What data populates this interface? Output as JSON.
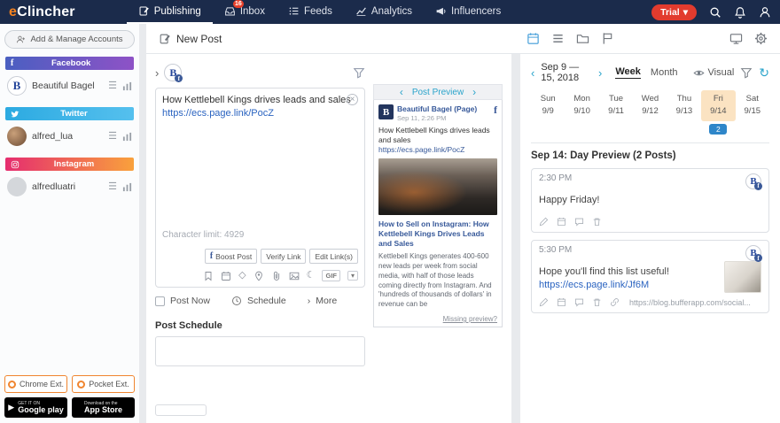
{
  "colors": {
    "brand_orange": "#f5821f",
    "navbar_navy": "#1b2b4b",
    "trial_red": "#e23b2e",
    "facebook_bar": "#4a5fc1",
    "twitter_bar": "#2caae1",
    "instagram_bar": "#e52d6f",
    "link_blue": "#365899",
    "selected_day_bg": "#fbe3c2",
    "count_badge_blue": "#2e86c9",
    "inbox_badge_red": "#e8402a"
  },
  "navbar": {
    "logo_prefix": "e",
    "logo_rest": "Clincher",
    "items": [
      {
        "label": "Publishing"
      },
      {
        "label": "Inbox",
        "badge": "16"
      },
      {
        "label": "Feeds"
      },
      {
        "label": "Analytics"
      },
      {
        "label": "Influencers"
      }
    ],
    "trial_label": "Trial"
  },
  "sidebar": {
    "add_accounts_label": "Add & Manage Accounts",
    "facebook": {
      "network": "Facebook",
      "account": "Beautiful Bagel"
    },
    "twitter": {
      "network": "Twitter",
      "account": "alfred_lua"
    },
    "instagram": {
      "network": "Instagram",
      "account": "alfredluatri"
    },
    "chrome_ext_label": "Chrome Ext.",
    "pocket_ext_label": "Pocket Ext.",
    "google_play_small_label": "GET IT ON",
    "google_play_label": "Google play",
    "app_store_small_label": "Download on the",
    "app_store_label": "App Store"
  },
  "toolbar": {
    "new_post_label": "New Post"
  },
  "composer": {
    "avatar_letter": "B",
    "text_line1": "How Kettlebell Kings drives leads and sales",
    "text_line2": "https://ecs.page.link/PocZ",
    "char_limit": "Character limit: 4929",
    "boost_label": "Boost Post",
    "verify_label": "Verify Link",
    "edit_links_label": "Edit Link(s)",
    "gif_label": "GIF",
    "post_now_label": "Post Now",
    "schedule_label": "Schedule",
    "more_label": "More",
    "post_schedule_label": "Post Schedule"
  },
  "preview": {
    "title": "Post Preview",
    "avatar_letter": "B",
    "page_name": "Beautiful Bagel (Page)",
    "timestamp": "Sep 11, 2:26 PM",
    "text": "How Kettlebell Kings drives leads and sales",
    "link": "https://ecs.page.link/PocZ",
    "card_title": "How to Sell on Instagram: How Kettlebell Kings Drives Leads and Sales",
    "card_desc": "Kettlebell Kings generates 400-600 new leads per week from social media, with half of those leads coming directly from Instagram. And 'hundreds of thousands of dollars' in revenue can be",
    "missing_label": "Missing preview?"
  },
  "calendar": {
    "range_label": "Sep 9 — 15, 2018",
    "week_label": "Week",
    "month_label": "Month",
    "visual_label": "Visual",
    "days": [
      {
        "name": "Sun",
        "date": "9/9"
      },
      {
        "name": "Mon",
        "date": "9/10"
      },
      {
        "name": "Tue",
        "date": "9/11"
      },
      {
        "name": "Wed",
        "date": "9/12"
      },
      {
        "name": "Thu",
        "date": "9/13"
      },
      {
        "name": "Fri",
        "date": "9/14"
      },
      {
        "name": "Sat",
        "date": "9/15"
      }
    ],
    "selected_day_badge": "2",
    "day_preview_title": "Sep 14: Day Preview (2 Posts)",
    "posts": [
      {
        "time": "2:30 PM",
        "avatar_letter": "B",
        "text": "Happy Friday!"
      },
      {
        "time": "5:30 PM",
        "avatar_letter": "B",
        "text": "Hope you'll find this list useful!",
        "link": "https://ecs.page.link/Jf6M",
        "footer_link": "https://blog.bufferapp.com/social..."
      }
    ]
  },
  "icons": {
    "caret_down": "▾",
    "chevron_left": "‹",
    "chevron_right": "›",
    "chevron_expand": "›",
    "hamburger": "☰",
    "diamond": "◇",
    "crescent": "☾",
    "refresh": "↻",
    "play": "▶",
    "close": "×",
    "facebook_f": "f"
  }
}
